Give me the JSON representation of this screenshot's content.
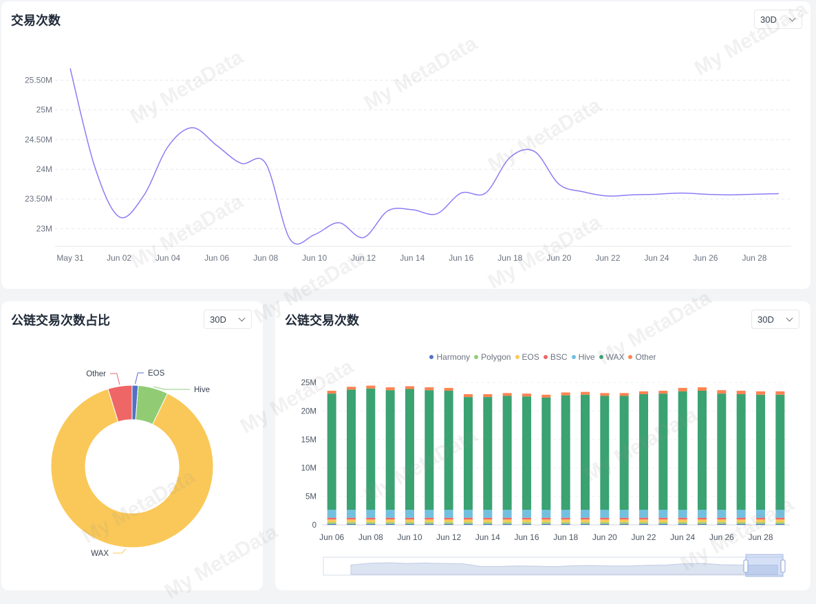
{
  "watermark": "My MetaData",
  "top_card": {
    "title": "交易次数",
    "range": "30D"
  },
  "pie_card": {
    "title": "公链交易次数占比",
    "range": "30D"
  },
  "bar_card": {
    "title": "公链交易次数",
    "range": "30D"
  },
  "chart_data": [
    {
      "type": "line",
      "title": "交易次数",
      "x": [
        "May 31",
        "Jun 01",
        "Jun 02",
        "Jun 03",
        "Jun 04",
        "Jun 05",
        "Jun 06",
        "Jun 07",
        "Jun 08",
        "Jun 09",
        "Jun 10",
        "Jun 11",
        "Jun 12",
        "Jun 13",
        "Jun 14",
        "Jun 15",
        "Jun 16",
        "Jun 17",
        "Jun 18",
        "Jun 19",
        "Jun 20",
        "Jun 21",
        "Jun 22",
        "Jun 23",
        "Jun 24",
        "Jun 25",
        "Jun 26",
        "Jun 27",
        "Jun 28",
        "Jun 29"
      ],
      "x_ticks": [
        "May 31",
        "Jun 02",
        "Jun 04",
        "Jun 06",
        "Jun 08",
        "Jun 10",
        "Jun 12",
        "Jun 14",
        "Jun 16",
        "Jun 18",
        "Jun 20",
        "Jun 22",
        "Jun 24",
        "Jun 26",
        "Jun 28"
      ],
      "series": [
        {
          "values": [
            25.7,
            24.05,
            23.2,
            23.55,
            24.38,
            24.7,
            24.4,
            24.1,
            24.1,
            22.82,
            22.9,
            23.1,
            22.85,
            23.3,
            23.32,
            23.25,
            23.6,
            23.6,
            24.2,
            24.3,
            23.75,
            23.62,
            23.55,
            23.57,
            23.58,
            23.6,
            23.58,
            23.57,
            23.58,
            23.59
          ],
          "color": "#8b7cf6"
        }
      ],
      "y_ticks": [
        "23M",
        "23.50M",
        "24M",
        "24.50M",
        "25M",
        "25.50M"
      ],
      "ylim": [
        22.75,
        25.9
      ],
      "grid": true
    },
    {
      "type": "pie",
      "title": "公链交易次数占比",
      "slices": [
        {
          "label": "EOS",
          "value": 1.2,
          "color": "#5470c6"
        },
        {
          "label": "Hive",
          "value": 6.0,
          "color": "#91cc75"
        },
        {
          "label": "WAX",
          "value": 88.0,
          "color": "#fac858"
        },
        {
          "label": "Other",
          "value": 4.8,
          "color": "#ee6666"
        }
      ]
    },
    {
      "type": "bar",
      "title": "公链交易次数",
      "categories": [
        "Jun 06",
        "Jun 07",
        "Jun 08",
        "Jun 09",
        "Jun 10",
        "Jun 11",
        "Jun 12",
        "Jun 13",
        "Jun 14",
        "Jun 15",
        "Jun 16",
        "Jun 17",
        "Jun 18",
        "Jun 19",
        "Jun 20",
        "Jun 21",
        "Jun 22",
        "Jun 23",
        "Jun 24",
        "Jun 25",
        "Jun 26",
        "Jun 27",
        "Jun 28",
        "Jun 29"
      ],
      "x_ticks": [
        "Jun 06",
        "Jun 08",
        "Jun 10",
        "Jun 12",
        "Jun 14",
        "Jun 16",
        "Jun 18",
        "Jun 20",
        "Jun 22",
        "Jun 24",
        "Jun 26",
        "Jun 28"
      ],
      "y_ticks": [
        "0",
        "5M",
        "10M",
        "15M",
        "20M",
        "25M"
      ],
      "ylim": [
        0,
        25
      ],
      "legend_position": "top",
      "series": [
        {
          "name": "Harmony",
          "color": "#5470c6",
          "values": [
            0.15,
            0.15,
            0.15,
            0.15,
            0.15,
            0.15,
            0.15,
            0.15,
            0.15,
            0.15,
            0.15,
            0.15,
            0.15,
            0.15,
            0.15,
            0.15,
            0.15,
            0.15,
            0.15,
            0.15,
            0.15,
            0.15,
            0.15,
            0.15
          ]
        },
        {
          "name": "Polygon",
          "color": "#91cc75",
          "values": [
            0.3,
            0.3,
            0.3,
            0.3,
            0.3,
            0.3,
            0.3,
            0.3,
            0.3,
            0.3,
            0.3,
            0.3,
            0.3,
            0.3,
            0.3,
            0.3,
            0.3,
            0.3,
            0.3,
            0.3,
            0.3,
            0.3,
            0.3,
            0.3
          ]
        },
        {
          "name": "EOS",
          "color": "#fac858",
          "values": [
            0.5,
            0.5,
            0.5,
            0.5,
            0.5,
            0.5,
            0.5,
            0.5,
            0.5,
            0.5,
            0.5,
            0.5,
            0.5,
            0.5,
            0.5,
            0.5,
            0.5,
            0.5,
            0.5,
            0.5,
            0.5,
            0.5,
            0.5,
            0.5
          ]
        },
        {
          "name": "BSC",
          "color": "#ee6666",
          "values": [
            0.3,
            0.3,
            0.3,
            0.3,
            0.3,
            0.3,
            0.3,
            0.3,
            0.3,
            0.3,
            0.3,
            0.3,
            0.3,
            0.3,
            0.3,
            0.3,
            0.3,
            0.3,
            0.3,
            0.3,
            0.3,
            0.3,
            0.3,
            0.3
          ]
        },
        {
          "name": "Hive",
          "color": "#73c0de",
          "values": [
            1.4,
            1.4,
            1.4,
            1.4,
            1.4,
            1.4,
            1.4,
            1.4,
            1.4,
            1.4,
            1.4,
            1.4,
            1.4,
            1.4,
            1.4,
            1.4,
            1.4,
            1.4,
            1.4,
            1.4,
            1.4,
            1.4,
            1.4,
            1.4
          ]
        },
        {
          "name": "WAX",
          "color": "#3ba272",
          "values": [
            20.4,
            21.1,
            21.3,
            21.0,
            21.2,
            21.0,
            20.9,
            19.8,
            19.8,
            20.0,
            19.9,
            19.7,
            20.1,
            20.2,
            20.0,
            20.0,
            20.3,
            20.4,
            20.8,
            20.9,
            20.4,
            20.3,
            20.2,
            20.2
          ]
        },
        {
          "name": "Other",
          "color": "#fc8452",
          "values": [
            0.5,
            0.5,
            0.5,
            0.5,
            0.5,
            0.5,
            0.5,
            0.5,
            0.5,
            0.5,
            0.5,
            0.5,
            0.5,
            0.5,
            0.5,
            0.5,
            0.5,
            0.5,
            0.6,
            0.6,
            0.6,
            0.6,
            0.6,
            0.6
          ]
        }
      ]
    }
  ]
}
